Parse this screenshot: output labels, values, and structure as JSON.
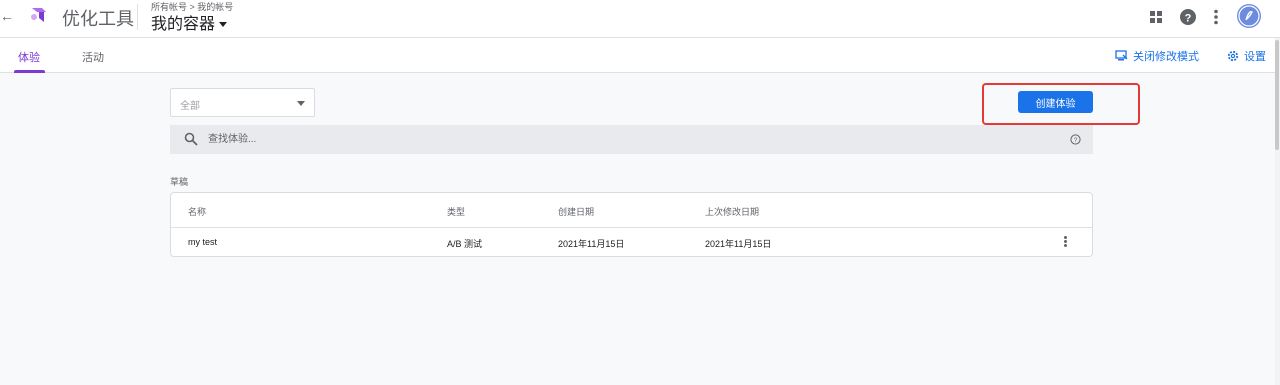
{
  "header": {
    "app_name": "优化工具",
    "breadcrumb": "所有帐号 > 我的帐号",
    "container_name": "我的容器",
    "icons": [
      "apps-grid-icon",
      "help-icon",
      "more-vert-icon",
      "avatar"
    ]
  },
  "tabs": [
    {
      "label": "体验",
      "active": true
    },
    {
      "label": "活动",
      "active": false
    }
  ],
  "header_actions": {
    "edit_mode_label": "关闭修改模式",
    "settings_label": "设置"
  },
  "filter": {
    "selected": "全部"
  },
  "create_button": {
    "label": "创建体验"
  },
  "search": {
    "placeholder": "查找体验..."
  },
  "drafts": {
    "section_label": "草稿",
    "columns": [
      "名称",
      "类型",
      "创建日期",
      "上次修改日期"
    ],
    "rows": [
      {
        "name": "my test",
        "type": "A/B 测试",
        "created": "2021年11月15日",
        "modified": "2021年11月15日"
      }
    ]
  },
  "colors": {
    "accent_purple": "#7b3ad6",
    "primary_blue": "#1a73e8",
    "highlight_red": "#e53935"
  }
}
